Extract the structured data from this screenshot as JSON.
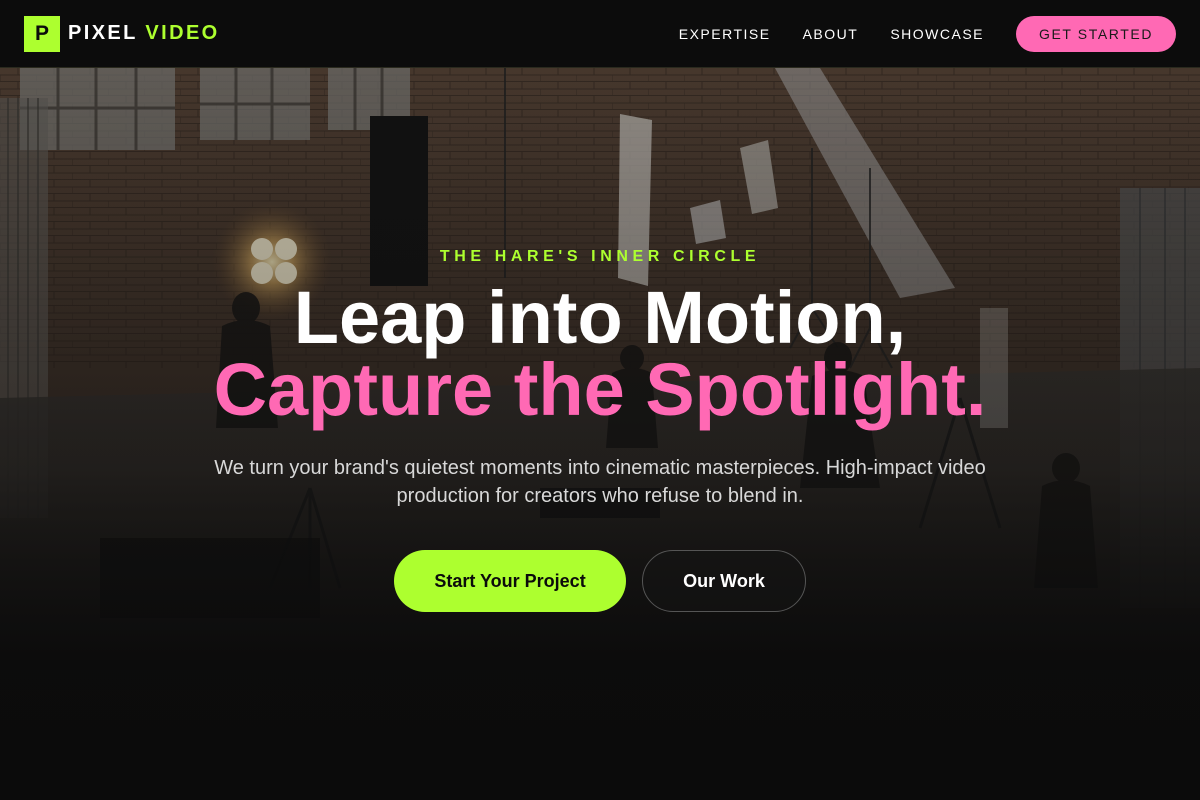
{
  "brand": {
    "mark": "P",
    "word1": "PIXEL",
    "word2": "VIDEO"
  },
  "nav": {
    "links": [
      "EXPERTISE",
      "ABOUT",
      "SHOWCASE"
    ],
    "cta_label": "GET STARTED"
  },
  "hero": {
    "eyebrow": "THE HARE'S INNER CIRCLE",
    "headline_line1": "Leap into Motion,",
    "headline_line2": "Capture the Spotlight.",
    "subtitle": "We turn your brand's quietest moments into cinematic masterpieces. High-impact video production for creators who refuse to blend in.",
    "primary_cta": "Start Your Project",
    "secondary_cta": "Our Work",
    "background": "film-studio-photo"
  },
  "colors": {
    "accent_green": "#adff2f",
    "accent_pink": "#ff69b4",
    "background": "#0b0b0b"
  }
}
